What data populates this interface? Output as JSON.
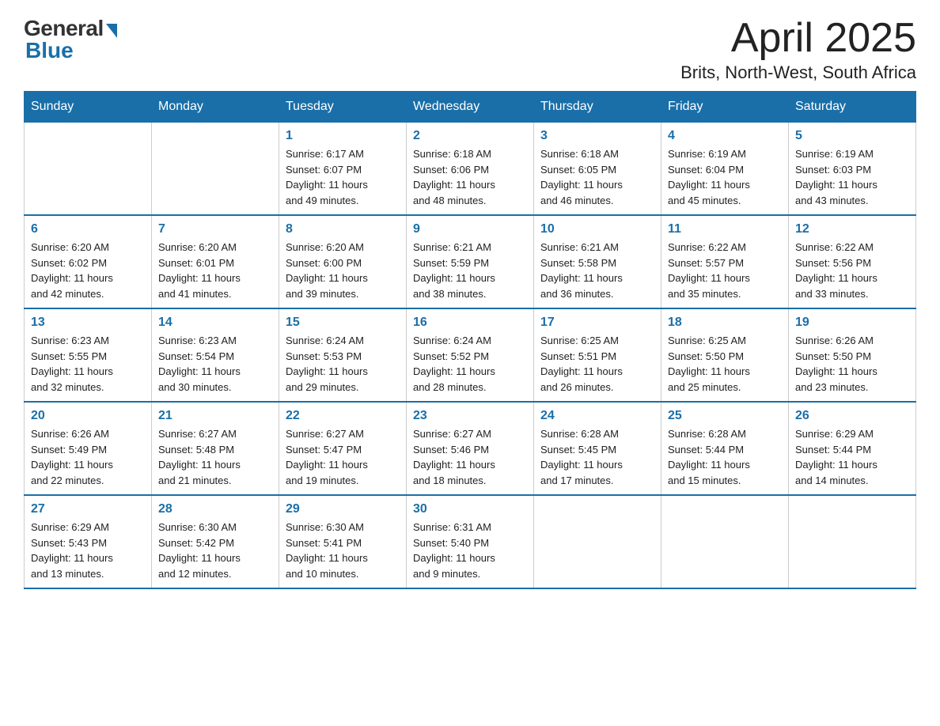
{
  "logo": {
    "general": "General",
    "blue": "Blue"
  },
  "header": {
    "month_title": "April 2025",
    "subtitle": "Brits, North-West, South Africa"
  },
  "days_of_week": [
    "Sunday",
    "Monday",
    "Tuesday",
    "Wednesday",
    "Thursday",
    "Friday",
    "Saturday"
  ],
  "weeks": [
    [
      {
        "day": "",
        "info": ""
      },
      {
        "day": "",
        "info": ""
      },
      {
        "day": "1",
        "info": "Sunrise: 6:17 AM\nSunset: 6:07 PM\nDaylight: 11 hours\nand 49 minutes."
      },
      {
        "day": "2",
        "info": "Sunrise: 6:18 AM\nSunset: 6:06 PM\nDaylight: 11 hours\nand 48 minutes."
      },
      {
        "day": "3",
        "info": "Sunrise: 6:18 AM\nSunset: 6:05 PM\nDaylight: 11 hours\nand 46 minutes."
      },
      {
        "day": "4",
        "info": "Sunrise: 6:19 AM\nSunset: 6:04 PM\nDaylight: 11 hours\nand 45 minutes."
      },
      {
        "day": "5",
        "info": "Sunrise: 6:19 AM\nSunset: 6:03 PM\nDaylight: 11 hours\nand 43 minutes."
      }
    ],
    [
      {
        "day": "6",
        "info": "Sunrise: 6:20 AM\nSunset: 6:02 PM\nDaylight: 11 hours\nand 42 minutes."
      },
      {
        "day": "7",
        "info": "Sunrise: 6:20 AM\nSunset: 6:01 PM\nDaylight: 11 hours\nand 41 minutes."
      },
      {
        "day": "8",
        "info": "Sunrise: 6:20 AM\nSunset: 6:00 PM\nDaylight: 11 hours\nand 39 minutes."
      },
      {
        "day": "9",
        "info": "Sunrise: 6:21 AM\nSunset: 5:59 PM\nDaylight: 11 hours\nand 38 minutes."
      },
      {
        "day": "10",
        "info": "Sunrise: 6:21 AM\nSunset: 5:58 PM\nDaylight: 11 hours\nand 36 minutes."
      },
      {
        "day": "11",
        "info": "Sunrise: 6:22 AM\nSunset: 5:57 PM\nDaylight: 11 hours\nand 35 minutes."
      },
      {
        "day": "12",
        "info": "Sunrise: 6:22 AM\nSunset: 5:56 PM\nDaylight: 11 hours\nand 33 minutes."
      }
    ],
    [
      {
        "day": "13",
        "info": "Sunrise: 6:23 AM\nSunset: 5:55 PM\nDaylight: 11 hours\nand 32 minutes."
      },
      {
        "day": "14",
        "info": "Sunrise: 6:23 AM\nSunset: 5:54 PM\nDaylight: 11 hours\nand 30 minutes."
      },
      {
        "day": "15",
        "info": "Sunrise: 6:24 AM\nSunset: 5:53 PM\nDaylight: 11 hours\nand 29 minutes."
      },
      {
        "day": "16",
        "info": "Sunrise: 6:24 AM\nSunset: 5:52 PM\nDaylight: 11 hours\nand 28 minutes."
      },
      {
        "day": "17",
        "info": "Sunrise: 6:25 AM\nSunset: 5:51 PM\nDaylight: 11 hours\nand 26 minutes."
      },
      {
        "day": "18",
        "info": "Sunrise: 6:25 AM\nSunset: 5:50 PM\nDaylight: 11 hours\nand 25 minutes."
      },
      {
        "day": "19",
        "info": "Sunrise: 6:26 AM\nSunset: 5:50 PM\nDaylight: 11 hours\nand 23 minutes."
      }
    ],
    [
      {
        "day": "20",
        "info": "Sunrise: 6:26 AM\nSunset: 5:49 PM\nDaylight: 11 hours\nand 22 minutes."
      },
      {
        "day": "21",
        "info": "Sunrise: 6:27 AM\nSunset: 5:48 PM\nDaylight: 11 hours\nand 21 minutes."
      },
      {
        "day": "22",
        "info": "Sunrise: 6:27 AM\nSunset: 5:47 PM\nDaylight: 11 hours\nand 19 minutes."
      },
      {
        "day": "23",
        "info": "Sunrise: 6:27 AM\nSunset: 5:46 PM\nDaylight: 11 hours\nand 18 minutes."
      },
      {
        "day": "24",
        "info": "Sunrise: 6:28 AM\nSunset: 5:45 PM\nDaylight: 11 hours\nand 17 minutes."
      },
      {
        "day": "25",
        "info": "Sunrise: 6:28 AM\nSunset: 5:44 PM\nDaylight: 11 hours\nand 15 minutes."
      },
      {
        "day": "26",
        "info": "Sunrise: 6:29 AM\nSunset: 5:44 PM\nDaylight: 11 hours\nand 14 minutes."
      }
    ],
    [
      {
        "day": "27",
        "info": "Sunrise: 6:29 AM\nSunset: 5:43 PM\nDaylight: 11 hours\nand 13 minutes."
      },
      {
        "day": "28",
        "info": "Sunrise: 6:30 AM\nSunset: 5:42 PM\nDaylight: 11 hours\nand 12 minutes."
      },
      {
        "day": "29",
        "info": "Sunrise: 6:30 AM\nSunset: 5:41 PM\nDaylight: 11 hours\nand 10 minutes."
      },
      {
        "day": "30",
        "info": "Sunrise: 6:31 AM\nSunset: 5:40 PM\nDaylight: 11 hours\nand 9 minutes."
      },
      {
        "day": "",
        "info": ""
      },
      {
        "day": "",
        "info": ""
      },
      {
        "day": "",
        "info": ""
      }
    ]
  ]
}
